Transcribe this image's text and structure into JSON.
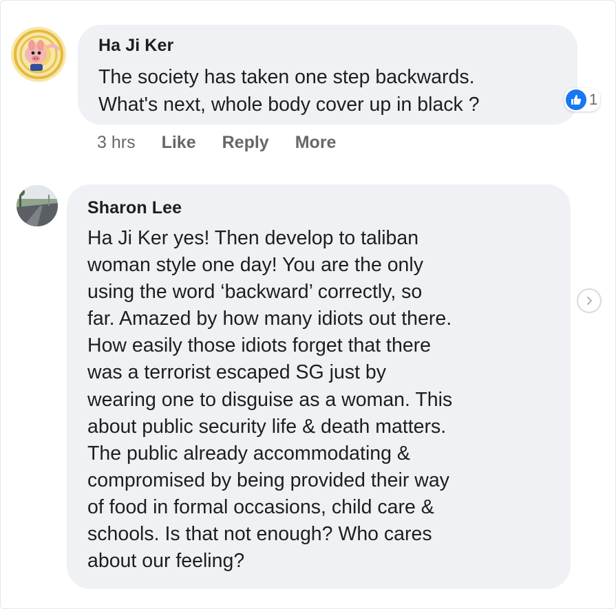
{
  "comments": [
    {
      "author": "Ha Ji Ker",
      "text": "The society has taken one step backwards.\nWhat's next, whole body cover up in black ?",
      "reaction_count": "1",
      "actions": {
        "time": "3 hrs",
        "like": "Like",
        "reply": "Reply",
        "more": "More"
      }
    },
    {
      "author": "Sharon Lee",
      "text": "Ha Ji Ker yes! Then develop to taliban\nwoman style one day! You are the only\nusing the word ‘backward’ correctly, so\nfar. Amazed by how many idiots out there.\nHow easily those idiots forget that there\nwas a terrorist escaped SG just by\nwearing one to disguise as a woman. This\nabout public security life & death matters.\nThe public already accommodating &\ncompromised by being provided their way\nof food in formal occasions, child care &\nschools. Is that not enough? Who cares\nabout our feeling?"
    }
  ],
  "icons": {
    "reaction": "like-thumb-icon",
    "navigation": "chevron-right-icon"
  },
  "colors": {
    "bubble": "#eff1f4",
    "text": "#1c1e21",
    "secondary_text": "#65676b",
    "like_blue": "#1877f2"
  }
}
